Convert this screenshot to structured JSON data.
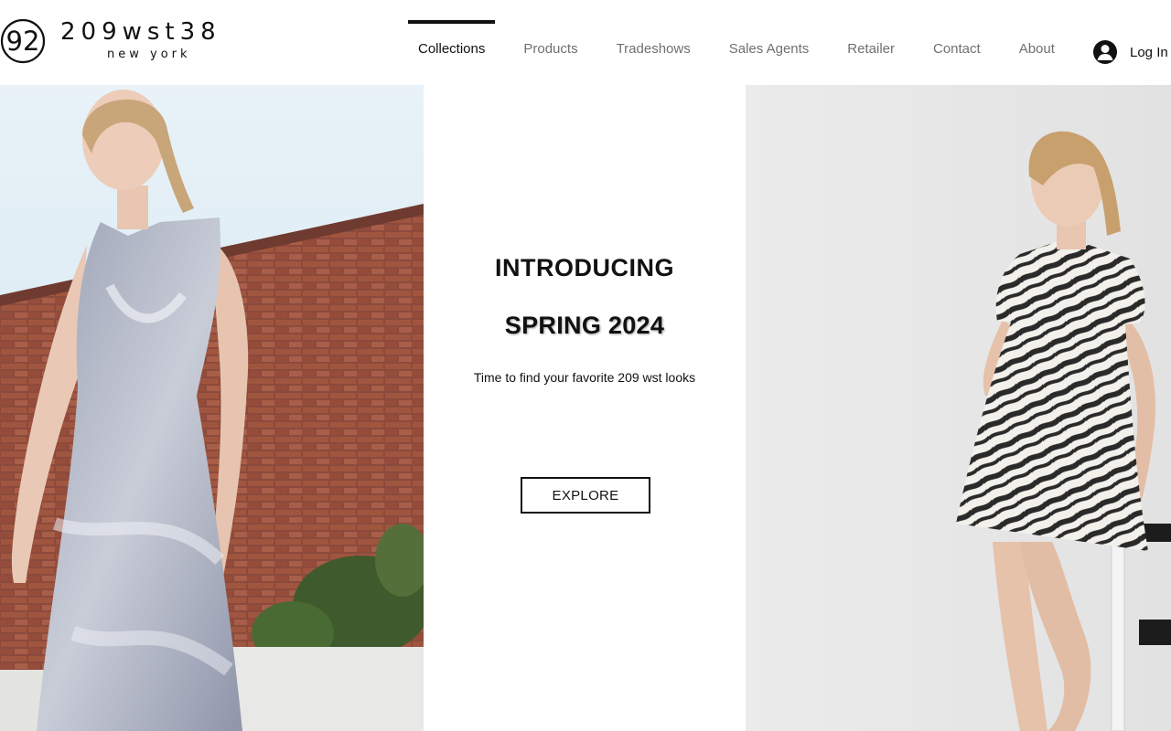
{
  "brand": {
    "monogram": "92",
    "name": "209wst38",
    "sub": "new york"
  },
  "nav": {
    "items": [
      {
        "label": "Collections",
        "active": true
      },
      {
        "label": "Products",
        "active": false
      },
      {
        "label": "Tradeshows",
        "active": false
      },
      {
        "label": "Sales Agents",
        "active": false
      },
      {
        "label": "Retailer",
        "active": false
      },
      {
        "label": "Contact",
        "active": false
      },
      {
        "label": "About",
        "active": false
      }
    ]
  },
  "account": {
    "icon": "user-avatar-icon",
    "label": "Log In"
  },
  "hero": {
    "headline_1": "INTRODUCING",
    "headline_2": "SPRING 2024",
    "tagline": "Time to find your favorite 209 wst looks",
    "cta_label": "EXPLORE"
  },
  "colors": {
    "text": "#111111",
    "nav_inactive": "#707070",
    "background": "#ffffff"
  }
}
